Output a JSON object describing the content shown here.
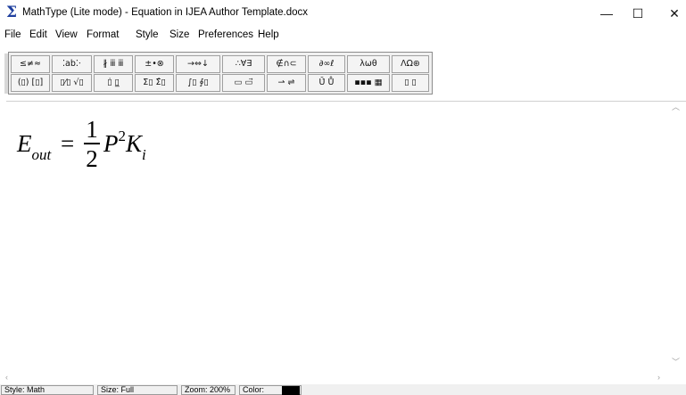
{
  "window": {
    "title": "MathType (Lite mode) - Equation in IJEA Author Template.docx",
    "icon": "mathtype-sigma-icon",
    "icon_glyph": "Σ",
    "controls": {
      "minimize": "—",
      "maximize": "☐",
      "close": "✕"
    }
  },
  "menu": [
    "File",
    "Edit",
    "View",
    "Format",
    "Style",
    "Size",
    "Preferences",
    "Help"
  ],
  "toolbar": {
    "row1": [
      "≤≠≈",
      "⁚ab⁚⋅",
      "∦ ⅲ ⅲ",
      "±•⊗",
      "→⇔↓",
      "∴∀∃",
      "∉∩⊂",
      "∂∞ℓ",
      "λωθ",
      "ΛΩ⊛"
    ],
    "row2": [
      "(▯) [▯]",
      "▯⁄▯ √▯",
      "▯̇ ▯̲",
      "Σ▯ Σ̂▯",
      "∫▯ ∮▯",
      "▭ ▭⃗",
      "⇀ ⇌",
      "Ū̇ Ů",
      "▪▪▪ ▦",
      "▯ ▯"
    ]
  },
  "equation": {
    "lhs_var": "E",
    "lhs_sub": "out",
    "equals": "=",
    "frac_num": "1",
    "frac_den": "2",
    "var1": "P",
    "var1_sup": "2",
    "var2": "K",
    "var2_sub": "i"
  },
  "status": {
    "style": "Style: Math",
    "size": "Size: Full",
    "zoom": "Zoom: 200%",
    "color_label": "Color:",
    "color_value": "#000000"
  },
  "colors": {
    "accent": "#1e3f9e"
  }
}
